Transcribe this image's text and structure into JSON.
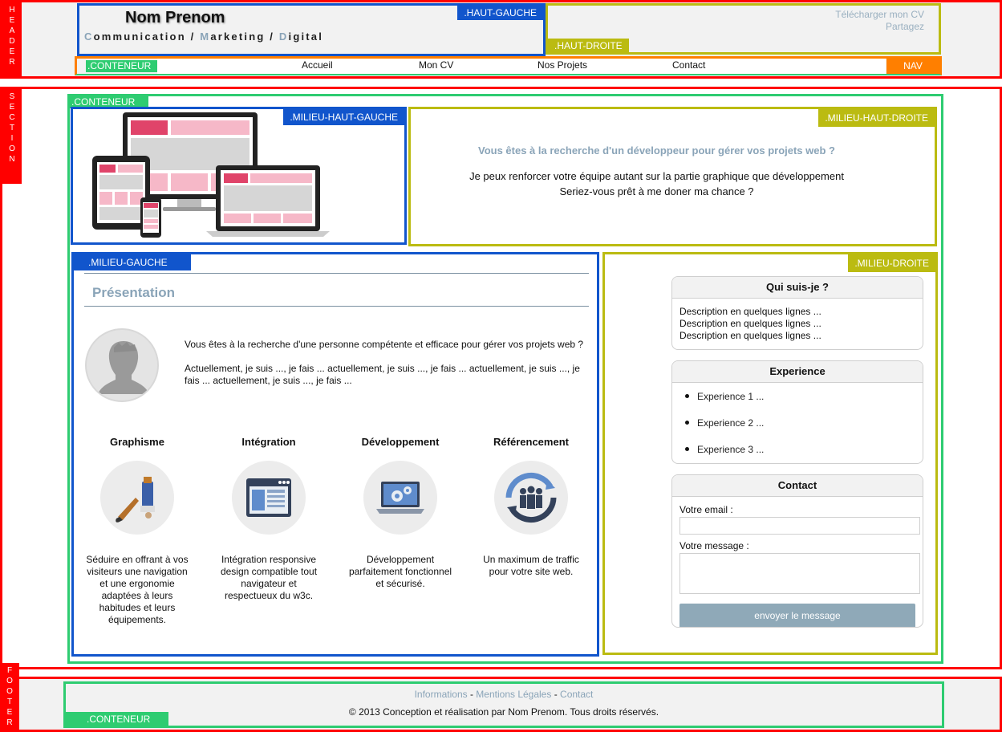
{
  "labels": {
    "header": [
      "H",
      "E",
      "A",
      "D",
      "E",
      "R"
    ],
    "section": [
      "S",
      "E",
      "C",
      "T",
      "I",
      "O",
      "N"
    ],
    "footer": [
      "F",
      "O",
      "O",
      "T",
      "E",
      "R"
    ],
    "conteneur": ".CONTENEUR",
    "haut_gauche": ".HAUT-GAUCHE",
    "haut_droite": ".HAUT-DROITE",
    "nav": "NAV",
    "milieu_haut_gauche": ".MILIEU-HAUT-GAUCHE",
    "milieu_haut_droite": ".MILIEU-HAUT-DROITE",
    "milieu_gauche": ".MILIEU-GAUCHE",
    "milieu_droite": ".MILIEU-DROITE"
  },
  "header": {
    "name": "Nom Prenom",
    "tagline": [
      {
        "initial": "C",
        "rest": "ommunication"
      },
      {
        "sep": " / "
      },
      {
        "initial": "M",
        "rest": "arketing"
      },
      {
        "sep": " / "
      },
      {
        "initial": "D",
        "rest": "igital"
      }
    ],
    "links": [
      "Télécharger mon CV",
      "Partagez"
    ]
  },
  "nav": {
    "items": [
      "Accueil",
      "Mon CV",
      "Nos Projets",
      "Contact"
    ]
  },
  "hero": {
    "question": "Vous êtes à la recherche d'un développeur pour gérer vos projets web ?",
    "line1": "Je peux renforcer votre équipe autant sur la partie graphique que développement",
    "line2": "Seriez-vous prêt à me doner ma chance ?"
  },
  "presentation": {
    "title": "Présentation",
    "paragraph1": "Vous êtes à la recherche d'une personne compétente et efficace pour gérer vos projets web ?",
    "paragraph2": "Actuellement, je suis ..., je fais ... actuellement, je suis ..., je fais ... actuellement, je suis ..., je fais ... actuellement, je suis ..., je fais ..."
  },
  "services": [
    {
      "title": "Graphisme",
      "icon": "paintbrush-icon",
      "desc": "Séduire en offrant à vos visiteurs une navigation et une ergonomie adaptées à leurs habitudes et leurs équipements."
    },
    {
      "title": "Intégration",
      "icon": "browser-window-icon",
      "desc": "Intégration responsive design compatible tout navigateur et respectueux du w3c."
    },
    {
      "title": "Développement",
      "icon": "laptop-gears-icon",
      "desc": "Développement parfaitement fonctionnel et sécurisé."
    },
    {
      "title": "Référencement",
      "icon": "people-cycle-icon",
      "desc": "Un maximum de traffic pour votre site web."
    }
  ],
  "about": {
    "title": "Qui suis-je ?",
    "lines": [
      "Description en quelques lignes ...",
      "Description en quelques lignes ...",
      "Description en quelques lignes ..."
    ]
  },
  "experience": {
    "title": "Experience",
    "items": [
      "Experience 1 ...",
      "Experience 2 ...",
      "Experience 3 ..."
    ]
  },
  "contact": {
    "title": "Contact",
    "email_label": "Votre email :",
    "email_value": "",
    "message_label": "Votre message :",
    "message_value": "",
    "submit_label": "envoyer le message"
  },
  "footer": {
    "links": [
      "Informations",
      "Mentions Légales",
      "Contact"
    ],
    "separator": " - ",
    "copyright": "© 2013 Conception et réalisation par Nom Prenom. Tous droits réservés."
  },
  "colors": {
    "region": "#ff0000",
    "conteneur": "#2ecc71",
    "blue_block": "#1155cc",
    "olive_block": "#bbbb11",
    "nav": "#ff7f00",
    "accent_text": "#8aa4b8"
  }
}
